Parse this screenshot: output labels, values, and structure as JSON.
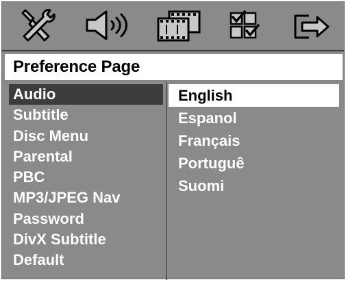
{
  "toolbar": {
    "icons": [
      {
        "name": "general-setup-tools-icon"
      },
      {
        "name": "audio-setup-speaker-icon"
      },
      {
        "name": "video-setup-filmstrip-icon"
      },
      {
        "name": "preference-setup-checkbox-icon"
      },
      {
        "name": "exit-arrow-icon"
      }
    ]
  },
  "page": {
    "title": "Preference Page"
  },
  "left_menu": {
    "selected_index": 0,
    "items": [
      {
        "label": "Audio"
      },
      {
        "label": "Subtitle"
      },
      {
        "label": "Disc Menu"
      },
      {
        "label": "Parental"
      },
      {
        "label": "PBC"
      },
      {
        "label": "MP3/JPEG Nav"
      },
      {
        "label": "Password"
      },
      {
        "label": "DivX Subtitle"
      },
      {
        "label": "Default"
      }
    ]
  },
  "options": {
    "selected_index": 0,
    "items": [
      {
        "label": "English"
      },
      {
        "label": "Espanol"
      },
      {
        "label": "Français"
      },
      {
        "label": "Portuguê"
      },
      {
        "label": "Suomi"
      }
    ]
  },
  "colors": {
    "background": "#8a8a8a",
    "selected_left": "#3c3c3c",
    "selected_right": "#ffffff",
    "text": "#ffffff"
  }
}
